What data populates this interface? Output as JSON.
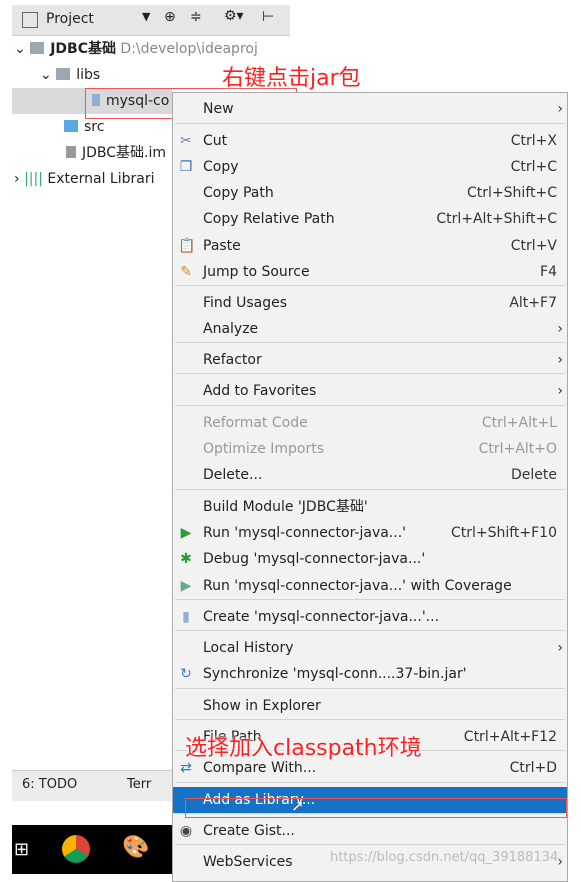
{
  "project_panel": {
    "title": "Project",
    "tree": [
      {
        "label": "JDBC基础",
        "path": "D:\\develop\\ideaproj"
      },
      {
        "label": "libs"
      },
      {
        "label": "mysql-co"
      },
      {
        "label": "src"
      },
      {
        "label": "JDBC基础.im"
      },
      {
        "label": "External Librari"
      }
    ]
  },
  "annotations": {
    "right_click": "右键点击jar包",
    "add_classpath": "选择加入classpath环境"
  },
  "menu": [
    {
      "label": "New",
      "submenu": true
    },
    {
      "label": "Cut",
      "shortcut": "Ctrl+X",
      "icon": "scissors-icon"
    },
    {
      "label": "Copy",
      "shortcut": "Ctrl+C",
      "icon": "copy-icon"
    },
    {
      "label": "Copy Path",
      "shortcut": "Ctrl+Shift+C"
    },
    {
      "label": "Copy Relative Path",
      "shortcut": "Ctrl+Alt+Shift+C"
    },
    {
      "label": "Paste",
      "shortcut": "Ctrl+V",
      "icon": "paste-icon"
    },
    {
      "label": "Jump to Source",
      "shortcut": "F4",
      "icon": "edit-icon"
    },
    {
      "label": "Find Usages",
      "shortcut": "Alt+F7"
    },
    {
      "label": "Analyze",
      "submenu": true
    },
    {
      "label": "Refactor",
      "submenu": true
    },
    {
      "label": "Add to Favorites",
      "submenu": true
    },
    {
      "label": "Reformat Code",
      "shortcut": "Ctrl+Alt+L",
      "disabled": true
    },
    {
      "label": "Optimize Imports",
      "shortcut": "Ctrl+Alt+O",
      "disabled": true
    },
    {
      "label": "Delete...",
      "shortcut": "Delete"
    },
    {
      "label": "Build Module 'JDBC基础'"
    },
    {
      "label": "Run 'mysql-connector-java...'",
      "shortcut": "Ctrl+Shift+F10",
      "icon": "run-icon"
    },
    {
      "label": "Debug 'mysql-connector-java...'",
      "icon": "debug-icon"
    },
    {
      "label": "Run 'mysql-connector-java...' with Coverage",
      "icon": "coverage-icon"
    },
    {
      "label": "Create 'mysql-connector-java...'...",
      "icon": "jar-icon"
    },
    {
      "label": "Local History",
      "submenu": true
    },
    {
      "label": "Synchronize 'mysql-conn....37-bin.jar'",
      "icon": "sync-icon"
    },
    {
      "label": "Show in Explorer"
    },
    {
      "label": "File Path",
      "shortcut": "Ctrl+Alt+F12"
    },
    {
      "label": "Compare With...",
      "shortcut": "Ctrl+D",
      "icon": "compare-icon"
    },
    {
      "label": "Add as Library...",
      "highlighted": true
    },
    {
      "label": "Create Gist...",
      "icon": "github-icon"
    },
    {
      "label": "WebServices",
      "submenu": true
    }
  ],
  "toolbar_bottom": {
    "todo": "6: TODO",
    "terminal": "Terr"
  },
  "watermark": "https://blog.csdn.net/qq_39188134",
  "colors": {
    "highlight": "#1572c7",
    "annotation": "#ff2020"
  }
}
